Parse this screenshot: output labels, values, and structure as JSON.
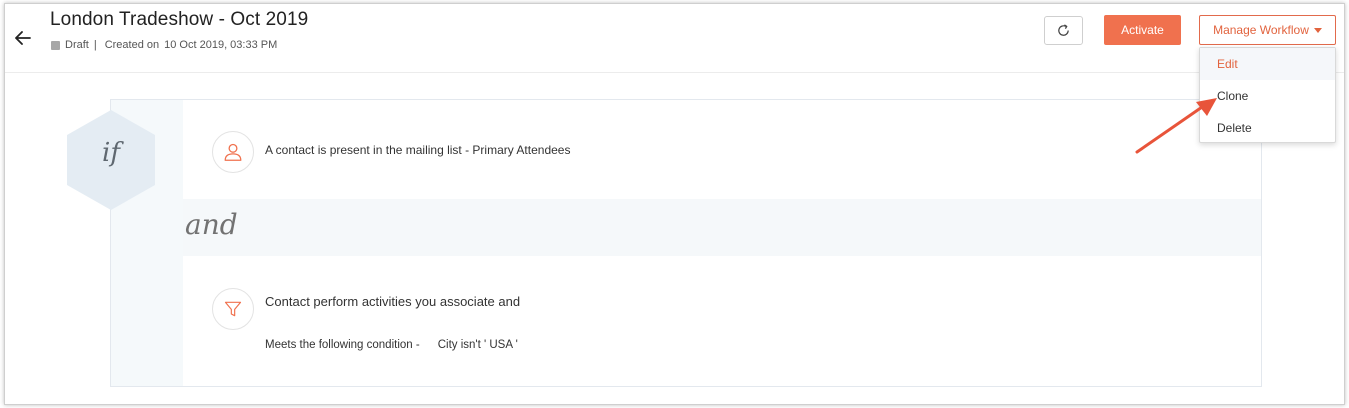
{
  "header": {
    "title": "London Tradeshow - Oct 2019",
    "status": "Draft",
    "status_separator": "|",
    "created_label": "Created on",
    "created_date": "10 Oct 2019, 03:33 PM"
  },
  "toolbar": {
    "activate_label": "Activate",
    "manage_label": "Manage Workflow"
  },
  "manage_menu": {
    "items": [
      {
        "label": "Edit"
      },
      {
        "label": "Clone"
      },
      {
        "label": "Delete"
      }
    ]
  },
  "workflow": {
    "if_label": "if",
    "and_label": "and",
    "condition1": {
      "text": "A contact is present in the mailing list - Primary Attendees",
      "icon": "user-icon"
    },
    "condition2": {
      "text": "Contact perform activities you associate and",
      "sub_label": "Meets the following condition -",
      "sub_value": "City isn't ' USA '",
      "icon": "filter-icon"
    }
  },
  "colors": {
    "accent": "#f0714e",
    "annotation_arrow": "#e8543a"
  }
}
